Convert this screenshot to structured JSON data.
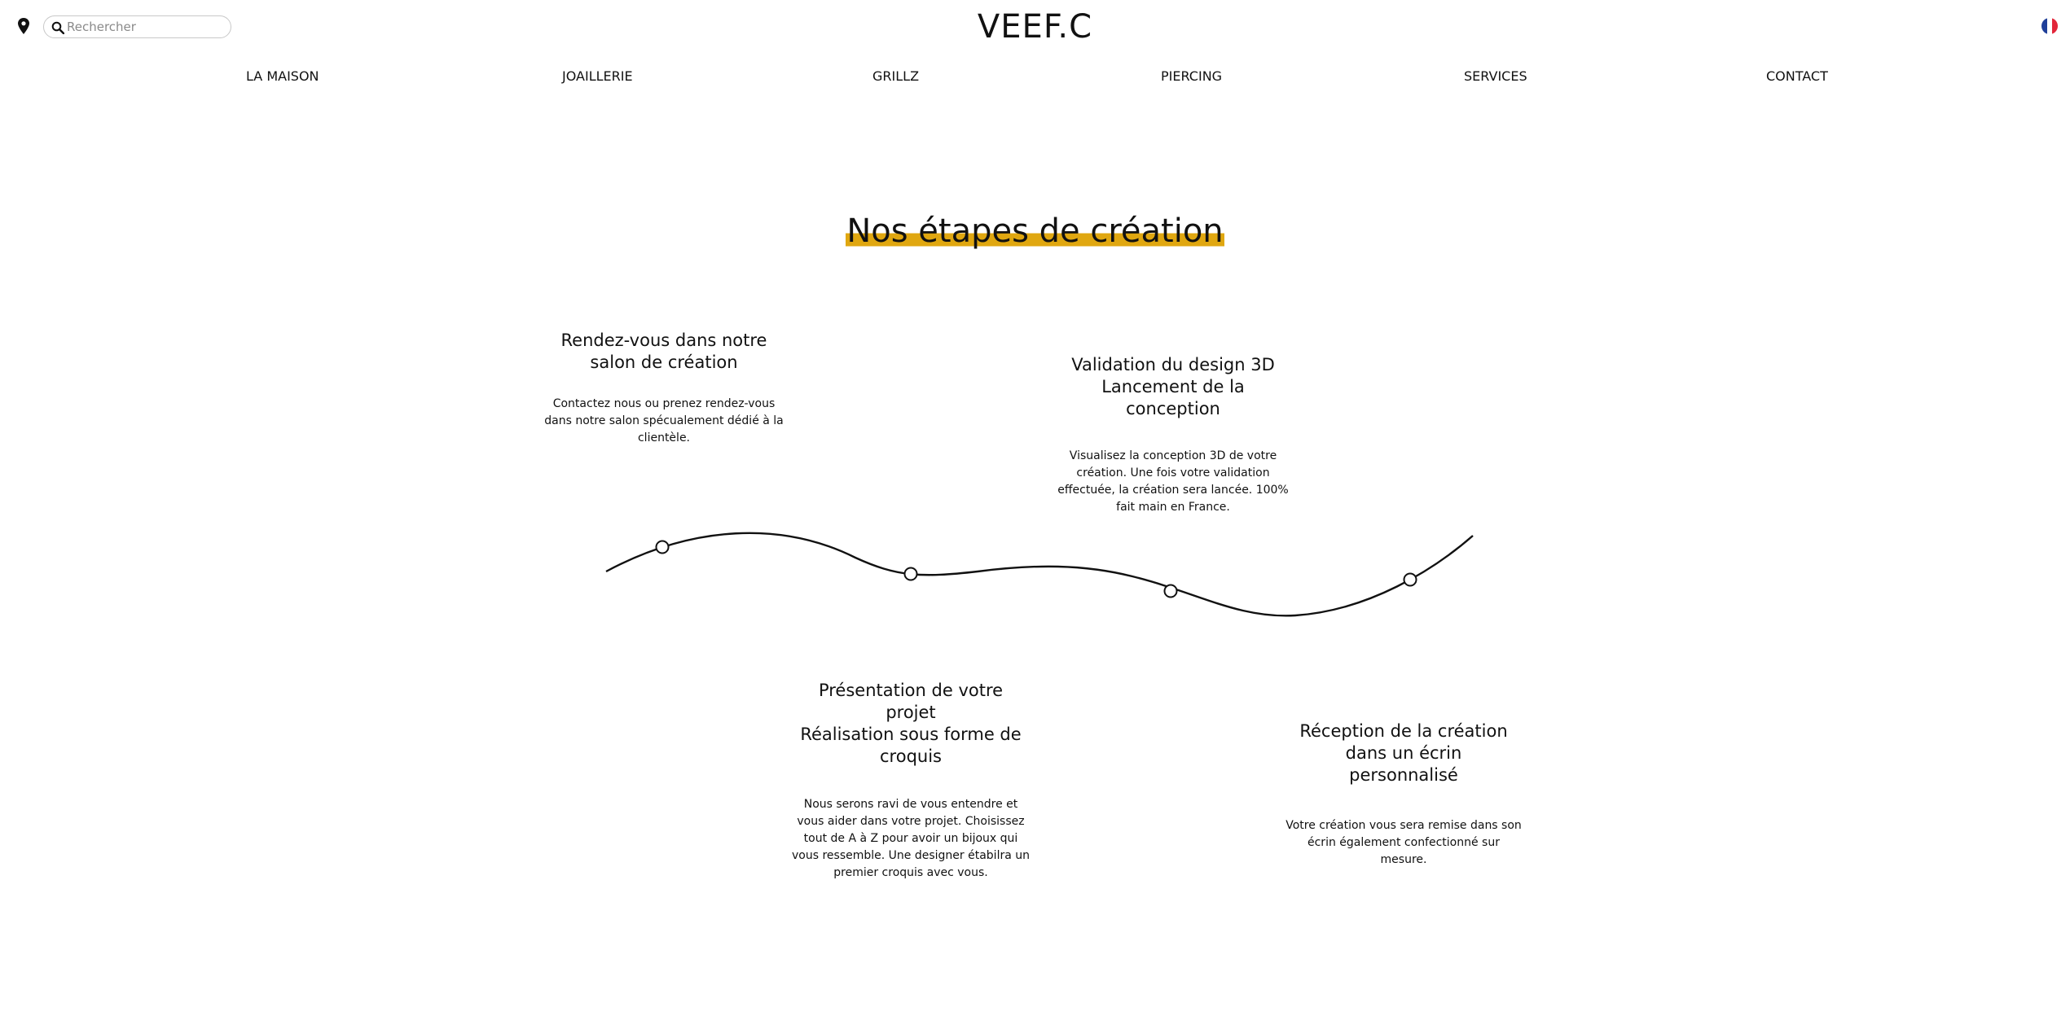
{
  "header": {
    "logo": "VEEF.C",
    "search_placeholder": "Rechercher",
    "location_icon": "map-pin-icon",
    "search_icon": "magnifier-icon",
    "language_flag": "fr-flag-icon"
  },
  "nav": {
    "items": [
      {
        "label": "LA MAISON"
      },
      {
        "label": "JOAILLERIE"
      },
      {
        "label": "GRILLZ"
      },
      {
        "label": "PIERCING"
      },
      {
        "label": "SERVICES"
      },
      {
        "label": "CONTACT"
      }
    ]
  },
  "section": {
    "title": "Nos étapes de création",
    "accent_color": "#e0a710"
  },
  "steps": [
    {
      "title_lines": [
        "Rendez-vous dans notre",
        "salon de création"
      ],
      "text_lines": [
        "Contactez nous ou prenez rendez-vous",
        "dans notre salon spécualement dédié à la",
        "clientèle."
      ]
    },
    {
      "title_lines": [
        "Présentation de votre",
        "projet",
        "Réalisation sous forme de",
        "croquis"
      ],
      "text_lines": [
        "Nous serons ravi de vous entendre et",
        "vous aider dans votre projet. Choisissez",
        "tout de A à Z pour avoir un bijoux qui",
        "vous ressemble. Une designer étabilra un",
        "premier croquis avec vous."
      ]
    },
    {
      "title_lines": [
        "Validation du design 3D",
        "Lancement de la",
        "conception"
      ],
      "text_lines": [
        "Visualisez la conception 3D de votre",
        "création. Une fois votre validation",
        "effectuée, la création sera lancée. 100%",
        "fait main en France."
      ]
    },
    {
      "title_lines": [
        "Réception de la création",
        "dans un écrin",
        "personnalisé"
      ],
      "text_lines": [
        "Votre création vous sera remise dans son",
        "écrin également confectionné sur",
        "mesure."
      ]
    }
  ]
}
